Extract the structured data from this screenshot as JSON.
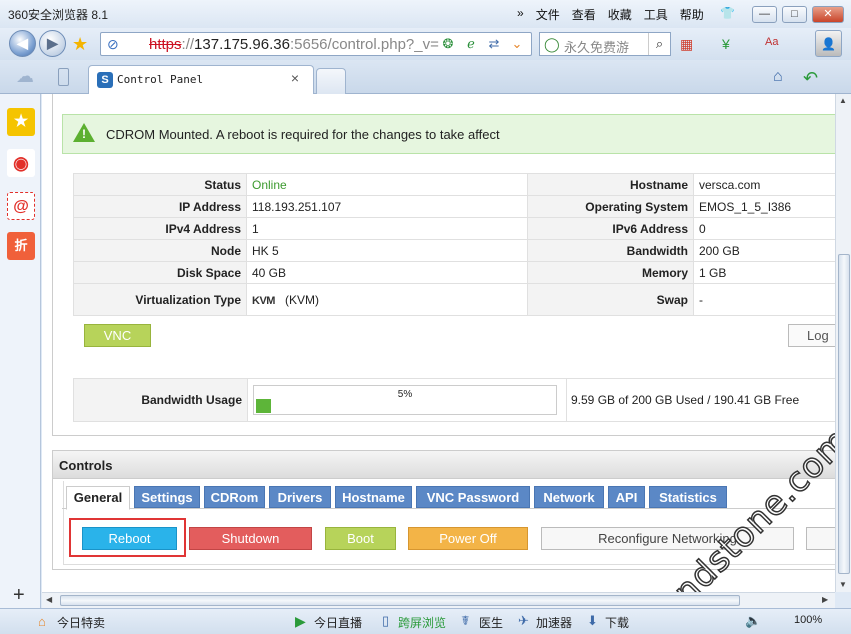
{
  "window": {
    "title": "360安全浏览器 8.1",
    "menu": [
      "»",
      "文件",
      "查看",
      "收藏",
      "工具",
      "帮助"
    ],
    "controls": {
      "minimize": "—",
      "maximize": "□",
      "close": "✕"
    }
  },
  "address": {
    "scheme": "https",
    "sep": "://",
    "host": "137.175.96.36",
    "rest": ":5656/control.php?_v="
  },
  "search": {
    "placeholder": "永久免费游",
    "go": "⌕"
  },
  "tab": {
    "title": "Control Panel",
    "close": "×",
    "favicon": "S"
  },
  "alert": {
    "text": "CDROM Mounted. A reboot is required for the changes to take affect"
  },
  "info": {
    "rows": [
      {
        "l1": "Status",
        "v1": "Online",
        "l2": "Hostname",
        "v2": "versca.com"
      },
      {
        "l1": "IP Address",
        "v1": "118.193.251.107",
        "l2": "Operating System",
        "v2": "EMOS_1_5_I386"
      },
      {
        "l1": "IPv4 Address",
        "v1": "1",
        "l2": "IPv6 Address",
        "v2": "0"
      },
      {
        "l1": "Node",
        "v1": "HK 5",
        "l2": "Bandwidth",
        "v2": "200 GB"
      },
      {
        "l1": "Disk Space",
        "v1": "40 GB",
        "l2": "Memory",
        "v2": "1 GB"
      },
      {
        "l1": "Virtualization Type",
        "v1_logo": "KVM",
        "v1": "(KVM)",
        "l2": "Swap",
        "v2": "-"
      }
    ]
  },
  "buttons": {
    "vnc": "VNC",
    "log": "Log"
  },
  "bandwidth": {
    "label": "Bandwidth Usage",
    "percent_text": "5%",
    "percent": 5,
    "used_text": "9.59 GB of 200 GB Used / 190.41 GB Free"
  },
  "controls": {
    "title": "Controls",
    "tabs": [
      "General",
      "Settings",
      "CDRom",
      "Drivers",
      "Hostname",
      "VNC Password",
      "Network",
      "API",
      "Statistics"
    ],
    "actions": {
      "reboot": "Reboot",
      "shutdown": "Shutdown",
      "boot": "Boot",
      "poweroff": "Power Off",
      "reconfigure": "Reconfigure Networking"
    }
  },
  "statusbar": {
    "items": [
      "今日特卖",
      "今日直播",
      "跨屏浏览",
      "医生",
      "加速器",
      "下载"
    ],
    "zoom": "100%"
  },
  "watermark": "bndstone.com",
  "colors": {
    "reboot": "#2ab3ea",
    "shutdown": "#e35d5d",
    "boot": "#b7d35a",
    "poweroff": "#f3b447",
    "tab_blue": "#5b88c6",
    "online": "#3c9a2e",
    "highlight": "#e03535"
  }
}
